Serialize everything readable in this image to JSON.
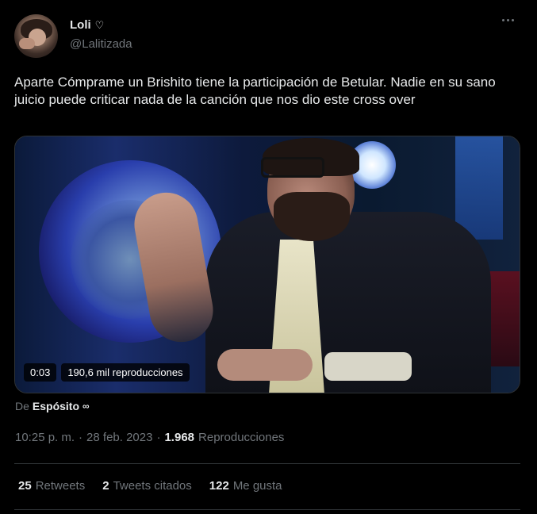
{
  "author": {
    "display_name": "Loli",
    "badge_icon": "heart-outline-icon",
    "handle": "@Lalitizada"
  },
  "tweet": {
    "text": "Aparte Cómprame un Brishito tiene la participación de Betular. Nadie en su sano juicio puede criticar nada de la canción que nos dio este cross over"
  },
  "video": {
    "timestamp": "0:03",
    "views": "190,6 mil reproducciones"
  },
  "attribution": {
    "prefix": "De",
    "source": "Espósito",
    "badge_icon": "infinity-icon"
  },
  "meta": {
    "time": "10:25 p. m.",
    "separator1": "·",
    "date": "28 feb. 2023",
    "separator2": "·",
    "views_count": "1.968",
    "views_label": "Reproducciones"
  },
  "stats": [
    {
      "count": "25",
      "label": "Retweets"
    },
    {
      "count": "2",
      "label": "Tweets citados"
    },
    {
      "count": "122",
      "label": "Me gusta"
    }
  ],
  "colors": {
    "background": "#000000",
    "text_primary": "#e7e9ea",
    "text_secondary": "#71767b",
    "border": "#2f3336"
  }
}
